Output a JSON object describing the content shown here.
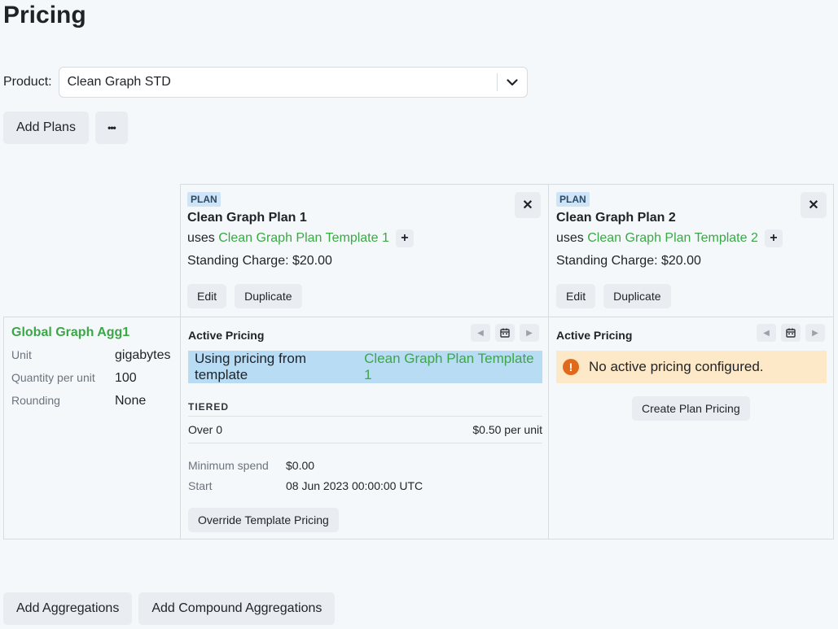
{
  "page": {
    "title": "Pricing"
  },
  "product": {
    "label": "Product:",
    "selected": "Clean Graph STD"
  },
  "toolbar": {
    "add_plans_label": "Add Plans",
    "more_label": "•••"
  },
  "plans": [
    {
      "badge": "PLAN",
      "name": "Clean Graph Plan 1",
      "uses_prefix": "uses",
      "template": "Clean Graph Plan Template 1",
      "standing_charge": "Standing Charge: $20.00",
      "edit_label": "Edit",
      "duplicate_label": "Duplicate"
    },
    {
      "badge": "PLAN",
      "name": "Clean Graph Plan 2",
      "uses_prefix": "uses",
      "template": "Clean Graph Plan Template 2",
      "standing_charge": "Standing Charge: $20.00",
      "edit_label": "Edit",
      "duplicate_label": "Duplicate"
    }
  ],
  "aggregation": {
    "name": "Global Graph Agg1",
    "fields": [
      {
        "key": "Unit",
        "value": "gigabytes"
      },
      {
        "key": "Quantity per unit",
        "value": "100"
      },
      {
        "key": "Rounding",
        "value": "None"
      }
    ]
  },
  "pricing_1": {
    "title": "Active Pricing",
    "banner_prefix": "Using pricing from template",
    "banner_template": "Clean Graph Plan Template 1",
    "tier_type": "TIERED",
    "tier_label": "Over 0",
    "tier_price": "$0.50 per unit",
    "min_spend_key": "Minimum spend",
    "min_spend_value": "$0.00",
    "start_key": "Start",
    "start_value": "08 Jun 2023 00:00:00 UTC",
    "override_label": "Override Template Pricing"
  },
  "pricing_2": {
    "title": "Active Pricing",
    "warning": "No active pricing configured.",
    "create_label": "Create Plan Pricing"
  },
  "bottom": {
    "add_aggregations_label": "Add Aggregations",
    "add_compound_label": "Add Compound Aggregations"
  },
  "icons": {
    "chevron_down": "chevron-down-icon",
    "close": "close-icon",
    "plus": "plus-icon",
    "calendar": "calendar-icon",
    "prev": "chevron-left-icon",
    "next": "chevron-right-icon",
    "warning": "warning-icon"
  },
  "colors": {
    "accent_green": "#3aa845",
    "info_bg": "#b9dcf5",
    "warning_bg": "#fde8c7",
    "warning_icon": "#e06a1b",
    "badge_bg": "#cfe4f6"
  }
}
